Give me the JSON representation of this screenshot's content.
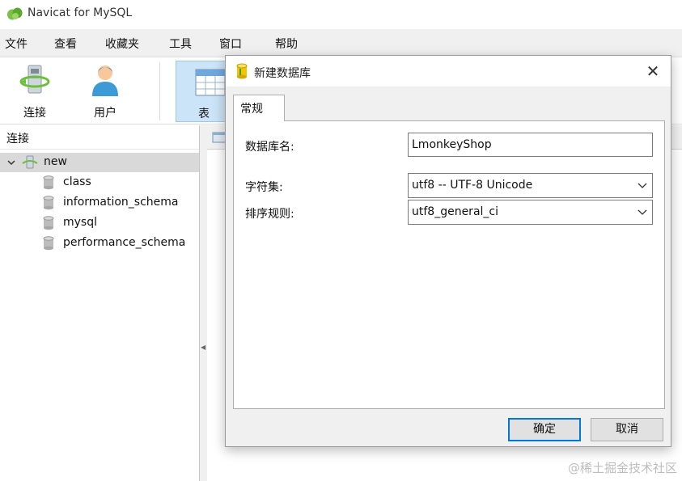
{
  "app": {
    "title": "Navicat for MySQL"
  },
  "menu": [
    "文件",
    "查看",
    "收藏夹",
    "工具",
    "窗口",
    "帮助"
  ],
  "toolbar": {
    "connect_label": "连接",
    "user_label": "用户",
    "table_label": "表"
  },
  "left_panel": {
    "header": "连接"
  },
  "tree": {
    "connection": "new",
    "databases": [
      "class",
      "information_schema",
      "mysql",
      "performance_schema"
    ]
  },
  "dialog": {
    "title": "新建数据库",
    "tab": "常规",
    "db_name_label": "数据库名:",
    "db_name_value": "LmonkeyShop",
    "charset_label": "字符集:",
    "charset_value": "utf8 -- UTF-8 Unicode",
    "collation_label": "排序规则:",
    "collation_value": "utf8_general_ci",
    "ok_label": "确定",
    "cancel_label": "取消",
    "close_symbol": "✕"
  },
  "watermark": "@稀土掘金技术社区",
  "colors": {
    "accent": "#0078d7",
    "selected_tool": "#cce4f7",
    "db_icon": "#f4c400"
  }
}
